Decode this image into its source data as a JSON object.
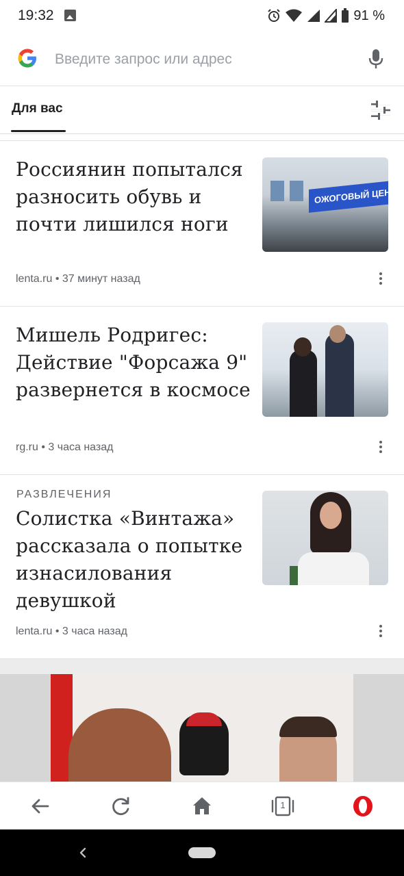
{
  "status_bar": {
    "time": "19:32",
    "battery": "91 %"
  },
  "search": {
    "placeholder": "Введите запрос или адрес"
  },
  "tabs": {
    "for_you": "Для вас"
  },
  "articles": [
    {
      "title": "Россиянин попытался разносить обувь и почти лишился ноги",
      "source": "lenta.ru",
      "time": "37 минут назад",
      "thumbnail_text": "ОЖОГОВЫЙ ЦЕН"
    },
    {
      "title": "Мишель Родригес: Действие \"Форсажа 9\" развернется в космосе",
      "source": "rg.ru",
      "time": "3 часа назад"
    },
    {
      "category": "РАЗВЛЕЧЕНИЯ",
      "title": "Солистка «Винтажа» рассказала о попытке изнасилования девушкой",
      "source": "lenta.ru",
      "time": "3 часа назад"
    }
  ],
  "meta_separator": "•",
  "bottom_nav": {
    "tab_count": "1"
  },
  "colors": {
    "text": "#202124",
    "meta": "#5f6368",
    "opera_red": "#e3121b"
  }
}
